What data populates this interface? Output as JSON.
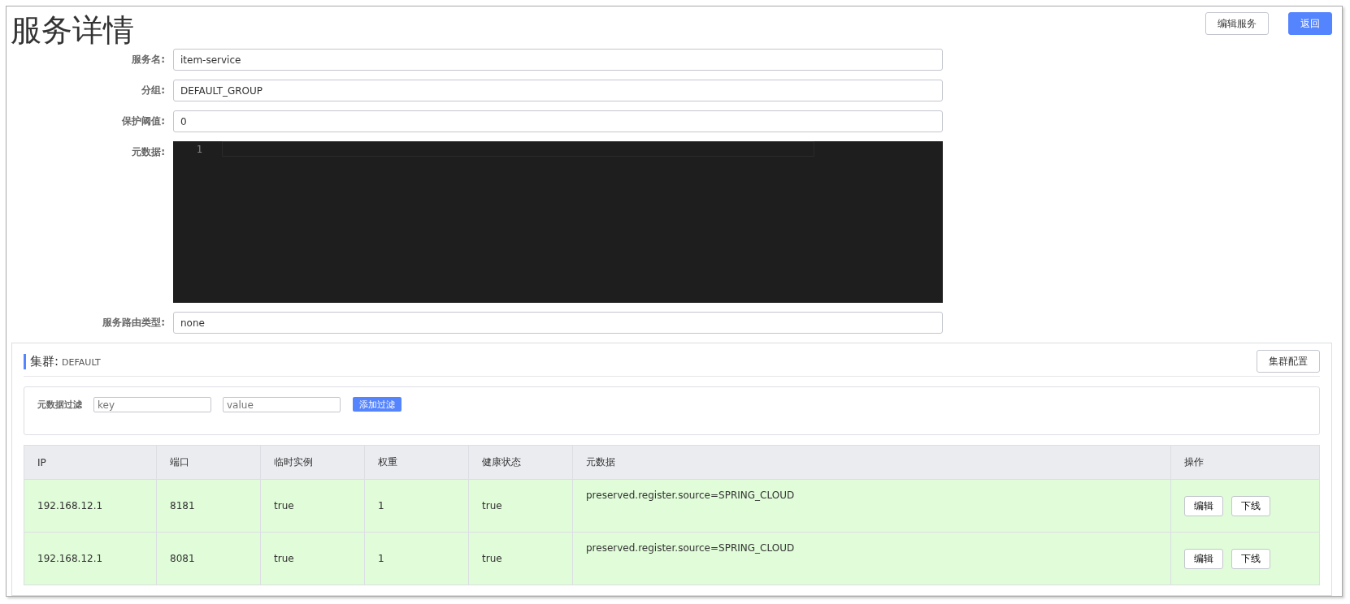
{
  "title": "服务详情",
  "header_buttons": [
    {
      "label": "编辑服务",
      "kind": "default"
    },
    {
      "label": "返回",
      "kind": "primary"
    }
  ],
  "form": [
    {
      "label": "服务名:",
      "kind": "input",
      "value": "item-service"
    },
    {
      "label": "分组:",
      "kind": "input",
      "value": "DEFAULT_GROUP"
    },
    {
      "label": "保护阈值:",
      "kind": "input",
      "value": "0"
    },
    {
      "label": "元数据:",
      "kind": "editor",
      "line_numbers": [
        "1"
      ]
    },
    {
      "label": "服务路由类型:",
      "kind": "input",
      "value": "none"
    }
  ],
  "cluster": {
    "label": "集群:",
    "name": "DEFAULT",
    "config_button": "集群配置",
    "filter": {
      "label": "元数据过滤",
      "key_placeholder": "key",
      "value_placeholder": "value",
      "button": "添加过滤"
    },
    "table": {
      "columns": [
        "IP",
        "端口",
        "临时实例",
        "权重",
        "健康状态",
        "元数据",
        "操作"
      ],
      "rows": [
        {
          "ip": "192.168.12.1",
          "port": "8181",
          "ephemeral": "true",
          "weight": "1",
          "healthy": "true",
          "metadata": "preserved.register.source=SPRING_CLOUD",
          "actions": [
            "编辑",
            "下线"
          ]
        },
        {
          "ip": "192.168.12.1",
          "port": "8081",
          "ephemeral": "true",
          "weight": "1",
          "healthy": "true",
          "metadata": "preserved.register.source=SPRING_CLOUD",
          "actions": [
            "编辑",
            "下线"
          ]
        }
      ]
    }
  }
}
